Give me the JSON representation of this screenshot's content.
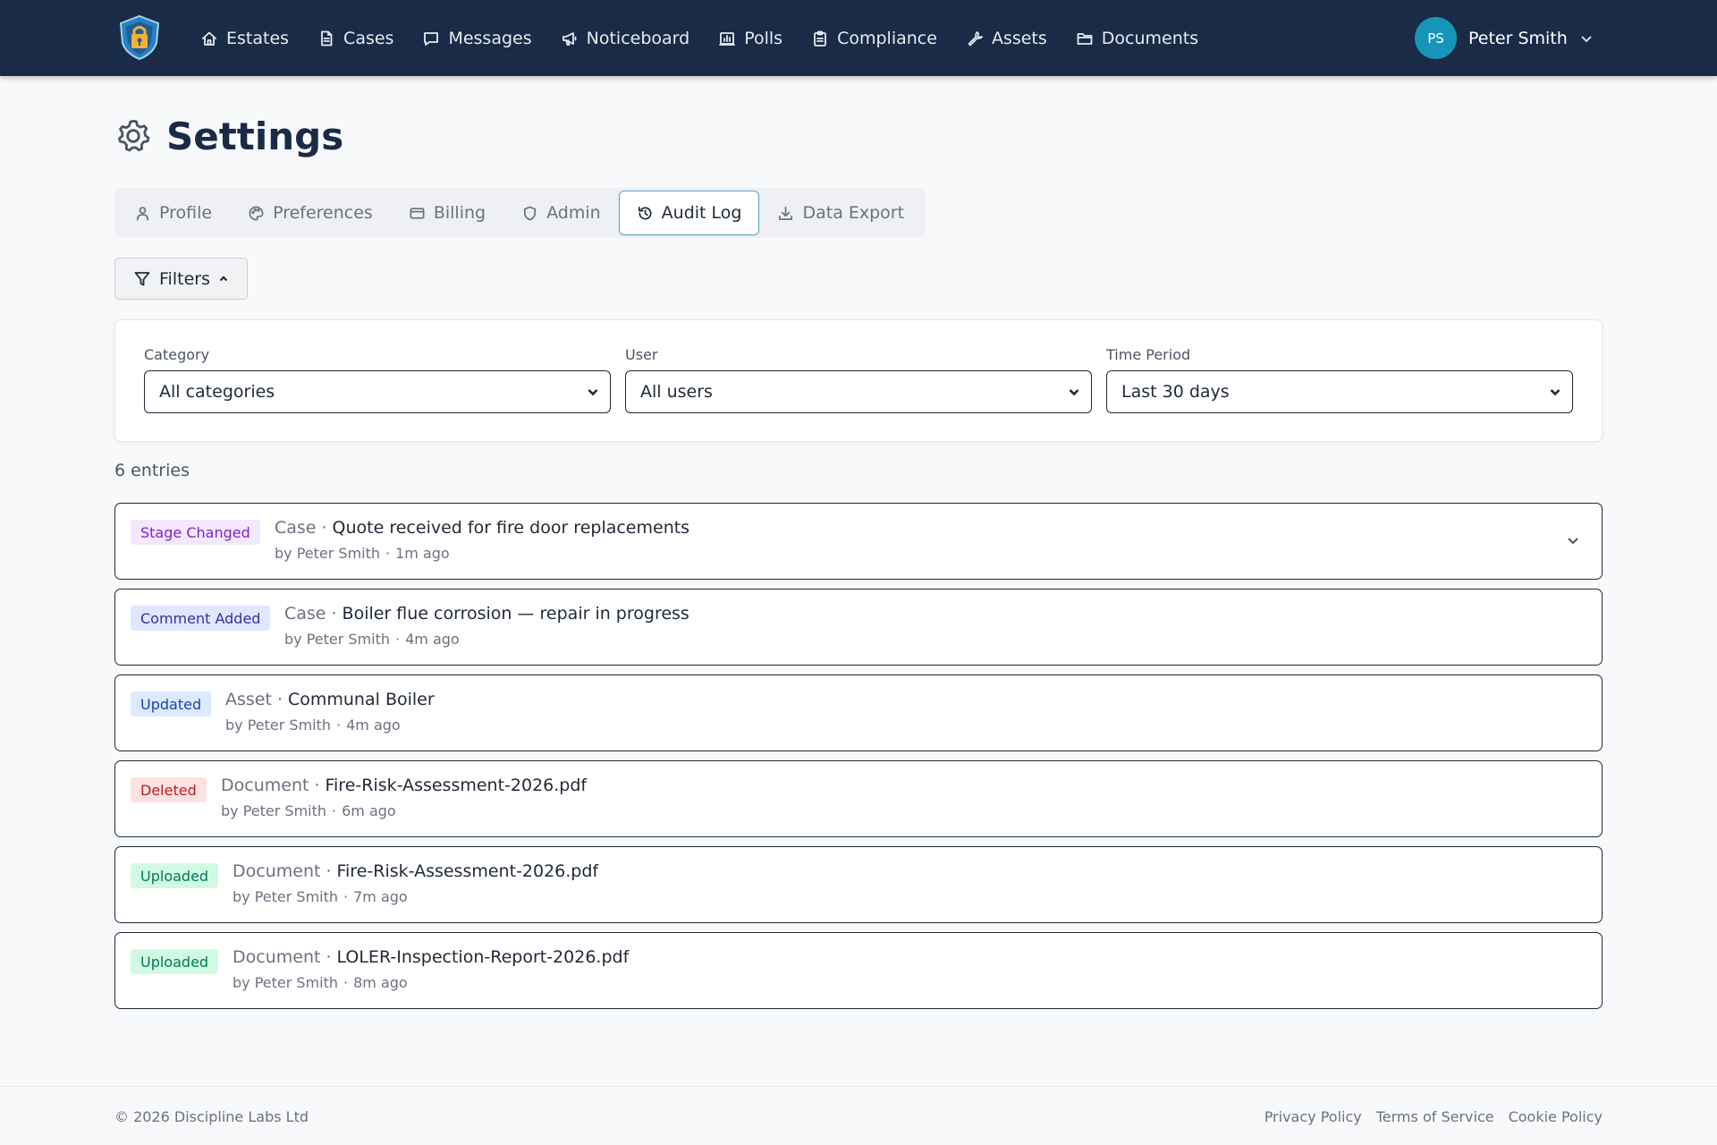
{
  "nav": {
    "items": [
      {
        "label": "Estates",
        "icon": "home-icon"
      },
      {
        "label": "Cases",
        "icon": "file-icon"
      },
      {
        "label": "Messages",
        "icon": "message-icon"
      },
      {
        "label": "Noticeboard",
        "icon": "megaphone-icon"
      },
      {
        "label": "Polls",
        "icon": "poll-icon"
      },
      {
        "label": "Compliance",
        "icon": "clipboard-icon"
      },
      {
        "label": "Assets",
        "icon": "wrench-icon"
      },
      {
        "label": "Documents",
        "icon": "folder-icon"
      }
    ],
    "user": {
      "initials": "PS",
      "name": "Peter Smith"
    }
  },
  "page": {
    "title": "Settings"
  },
  "tabs": [
    {
      "label": "Profile",
      "icon": "user-icon"
    },
    {
      "label": "Preferences",
      "icon": "palette-icon"
    },
    {
      "label": "Billing",
      "icon": "credit-card-icon"
    },
    {
      "label": "Admin",
      "icon": "shield-icon"
    },
    {
      "label": "Audit Log",
      "icon": "history-icon",
      "active": true
    },
    {
      "label": "Data Export",
      "icon": "download-icon"
    }
  ],
  "filters": {
    "button_label": "Filters",
    "category": {
      "label": "Category",
      "value": "All categories"
    },
    "user": {
      "label": "User",
      "value": "All users"
    },
    "period": {
      "label": "Time Period",
      "value": "Last 30 days"
    }
  },
  "entry_count": "6 entries",
  "entries": [
    {
      "badge": "Stage Changed",
      "badge_bg": "#f3e8ff",
      "badge_fg": "#7e22ce",
      "type": "Case",
      "title": "Quote received for fire door replacements",
      "by": "by Peter Smith",
      "time": "1m ago"
    },
    {
      "badge": "Comment Added",
      "badge_bg": "#e0e7ff",
      "badge_fg": "#3730a3",
      "type": "Case",
      "title": "Boiler flue corrosion — repair in progress",
      "by": "by Peter Smith",
      "time": "4m ago"
    },
    {
      "badge": "Updated",
      "badge_bg": "#dbeafe",
      "badge_fg": "#1e40af",
      "type": "Asset",
      "title": "Communal Boiler",
      "by": "by Peter Smith",
      "time": "4m ago"
    },
    {
      "badge": "Deleted",
      "badge_bg": "#fee2e2",
      "badge_fg": "#b91c1c",
      "type": "Document",
      "title": "Fire-Risk-Assessment-2026.pdf",
      "by": "by Peter Smith",
      "time": "6m ago"
    },
    {
      "badge": "Uploaded",
      "badge_bg": "#d1fae5",
      "badge_fg": "#047857",
      "type": "Document",
      "title": "Fire-Risk-Assessment-2026.pdf",
      "by": "by Peter Smith",
      "time": "7m ago"
    },
    {
      "badge": "Uploaded",
      "badge_bg": "#d1fae5",
      "badge_fg": "#047857",
      "type": "Document",
      "title": "LOLER-Inspection-Report-2026.pdf",
      "by": "by Peter Smith",
      "time": "8m ago"
    }
  ],
  "footer": {
    "copyright": "© 2026 Discipline Labs Ltd",
    "links": [
      "Privacy Policy",
      "Terms of Service",
      "Cookie Policy"
    ]
  }
}
